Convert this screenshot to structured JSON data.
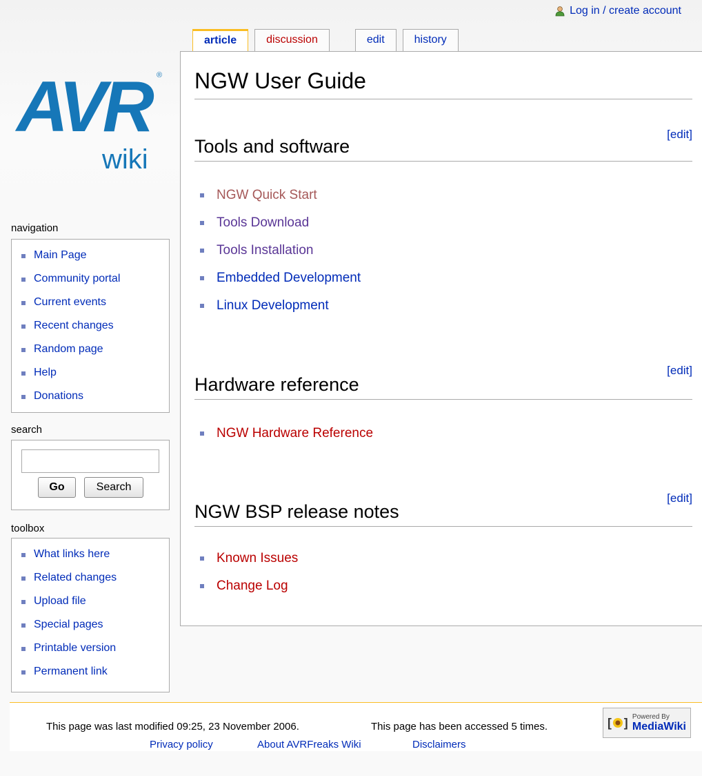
{
  "personal": {
    "login_label": "Log in / create account"
  },
  "tabs": [
    {
      "label": "article"
    },
    {
      "label": "discussion"
    },
    {
      "label": "edit"
    },
    {
      "label": "history"
    }
  ],
  "logo": {
    "main": "AVR",
    "sub": "wiki",
    "reg": "®"
  },
  "navigation": {
    "heading": "navigation",
    "items": [
      "Main Page",
      "Community portal",
      "Current events",
      "Recent changes",
      "Random page",
      "Help",
      "Donations"
    ]
  },
  "search": {
    "heading": "search",
    "value": "",
    "go_label": "Go",
    "search_label": "Search"
  },
  "toolbox": {
    "heading": "toolbox",
    "items": [
      "What links here",
      "Related changes",
      "Upload file",
      "Special pages",
      "Printable version",
      "Permanent link"
    ]
  },
  "content": {
    "title": "NGW User Guide",
    "edit_label": "[edit]",
    "sections": [
      {
        "heading": "Tools and software",
        "links": [
          "NGW Quick Start",
          "Tools Download",
          "Tools Installation",
          "Embedded Development",
          "Linux Development"
        ]
      },
      {
        "heading": "Hardware reference",
        "links": [
          "NGW Hardware Reference"
        ]
      },
      {
        "heading": "NGW BSP release notes",
        "links": [
          "Known Issues",
          "Change Log"
        ]
      }
    ]
  },
  "footer": {
    "last_modified": "This page was last modified 09:25, 23 November 2006.",
    "accessed": "This page has been accessed 5 times.",
    "links": [
      "Privacy policy",
      "About AVRFreaks Wiki",
      "Disclaimers"
    ],
    "badge_small": "Powered By",
    "badge_big": "MediaWiki"
  }
}
